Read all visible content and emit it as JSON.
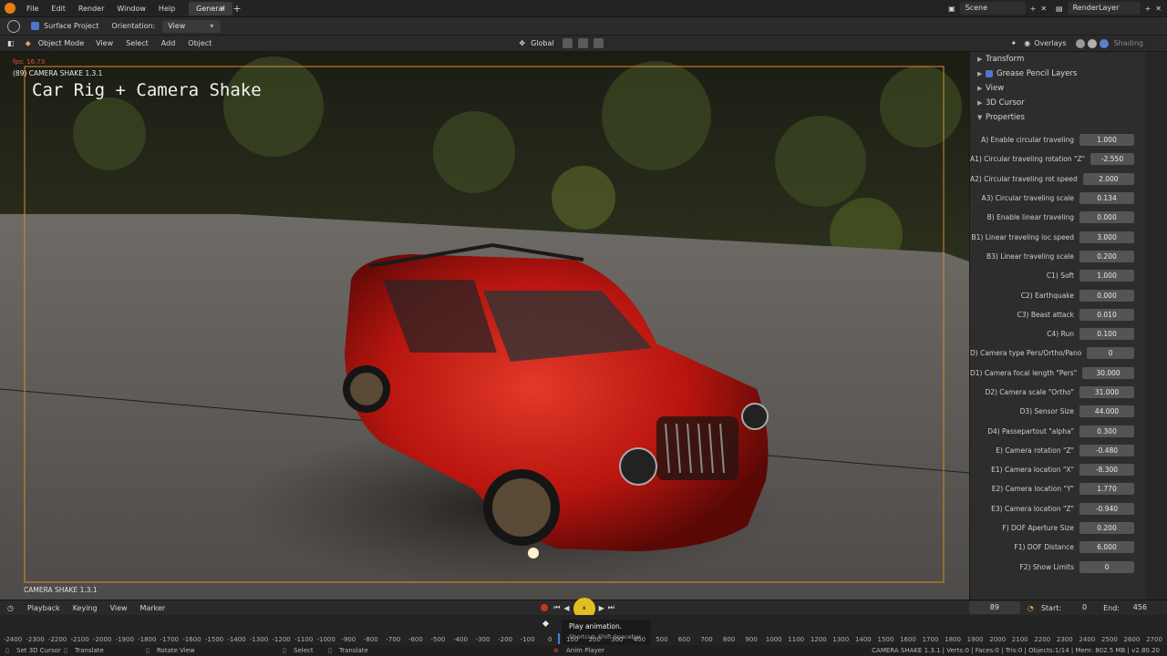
{
  "topbar": {
    "menus": [
      "File",
      "Edit",
      "Render",
      "Window",
      "Help"
    ],
    "tab": "General",
    "scene": "Scene",
    "render_layer": "RenderLayer"
  },
  "toolbar": {
    "surface_project": "Surface Project",
    "orientation_label": "Orientation:",
    "orientation_value": "View"
  },
  "header": {
    "mode": "Object Mode",
    "menus": [
      "View",
      "Select",
      "Add",
      "Object"
    ],
    "transform": "Global",
    "overlays": "Overlays",
    "shading": "Shading"
  },
  "viewport": {
    "fps": "fps: 16.73",
    "frame_label": "(89) CAMERA SHAKE 1.3.1",
    "title_overlay": "Car Rig + Camera Shake",
    "camera_name": "CAMERA SHAKE 1.3.1"
  },
  "npanel": {
    "sections": [
      "Transform",
      "Grease Pencil Layers",
      "View",
      "3D Cursor",
      "Properties"
    ],
    "properties": [
      {
        "label": "A) Enable circular traveling",
        "value": "1.000"
      },
      {
        "label": "A1) Circular traveling rotation \"Z\"",
        "value": "-2.550"
      },
      {
        "label": "A2) Circular traveling rot speed",
        "value": "2.000"
      },
      {
        "label": "A3) Circular traveling scale",
        "value": "0.134"
      },
      {
        "label": "B) Enable linear traveling",
        "value": "0.000"
      },
      {
        "label": "B1) Linear traveling loc speed",
        "value": "3.000"
      },
      {
        "label": "B3) Linear traveling scale",
        "value": "0.200"
      },
      {
        "label": "C1) Soft",
        "value": "1.000"
      },
      {
        "label": "C2) Earthquake",
        "value": "0.000"
      },
      {
        "label": "C3) Beast attack",
        "value": "0.010"
      },
      {
        "label": "C4) Run",
        "value": "0.100"
      },
      {
        "label": "D) Camera type Pers/Ortho/Pano",
        "value": "0"
      },
      {
        "label": "D1) Camera focal length \"Pers\"",
        "value": "30.000"
      },
      {
        "label": "D2) Camera scale \"Ortho\"",
        "value": "31.000"
      },
      {
        "label": "D3) Sensor Size",
        "value": "44.000"
      },
      {
        "label": "D4) Passepartout \"alpha\"",
        "value": "0.300"
      },
      {
        "label": "E) Camera rotation \"Z\"",
        "value": "-0.480"
      },
      {
        "label": "E1) Camera location \"X\"",
        "value": "-8.300"
      },
      {
        "label": "E2) Camera  location \"Y\"",
        "value": "1.770"
      },
      {
        "label": "E3) Camera  location \"Z\"",
        "value": "-0.940"
      },
      {
        "label": "F) DOF Aperture Size",
        "value": "0.200"
      },
      {
        "label": "F1) DOF Distance",
        "value": "6.000"
      },
      {
        "label": "F2) Show Limits",
        "value": "0"
      }
    ]
  },
  "timeline": {
    "menus": [
      "Playback",
      "Keying",
      "View",
      "Marker"
    ],
    "current_frame": "89",
    "start_label": "Start:",
    "start": "0",
    "end_label": "End:",
    "end": "456",
    "ticks": [
      "-2400",
      "-2300",
      "-2200",
      "-2100",
      "-2000",
      "-1900",
      "-1800",
      "-1700",
      "-1600",
      "-1500",
      "-1400",
      "-1300",
      "-1200",
      "-1100",
      "-1000",
      "-900",
      "-800",
      "-700",
      "-600",
      "-500",
      "-400",
      "-300",
      "-200",
      "-100",
      "0",
      "100",
      "200",
      "300",
      "400",
      "500",
      "600",
      "700",
      "800",
      "900",
      "1000",
      "1100",
      "1200",
      "1300",
      "1400",
      "1500",
      "1600",
      "1700",
      "1800",
      "1900",
      "2000",
      "2100",
      "2200",
      "2300",
      "2400",
      "2500",
      "2600",
      "2700"
    ],
    "tooltip_title": "Play animation.",
    "tooltip_shortcut": "Shortcut: Shift Spacebar"
  },
  "statusbar": {
    "items": [
      "Set 3D Cursor",
      "Translate",
      "Rotate View",
      "Select",
      "Translate"
    ],
    "center": "Anim Player",
    "stats": "CAMERA SHAKE 1.3.1 | Verts:0 | Faces:0 | Tris:0 | Objects:1/14 | Mem: 802.5 MB | v2.80.20"
  },
  "colors": {
    "accent": "#e08a26",
    "car": "#b8150f",
    "panel": "#2d2d2d"
  }
}
